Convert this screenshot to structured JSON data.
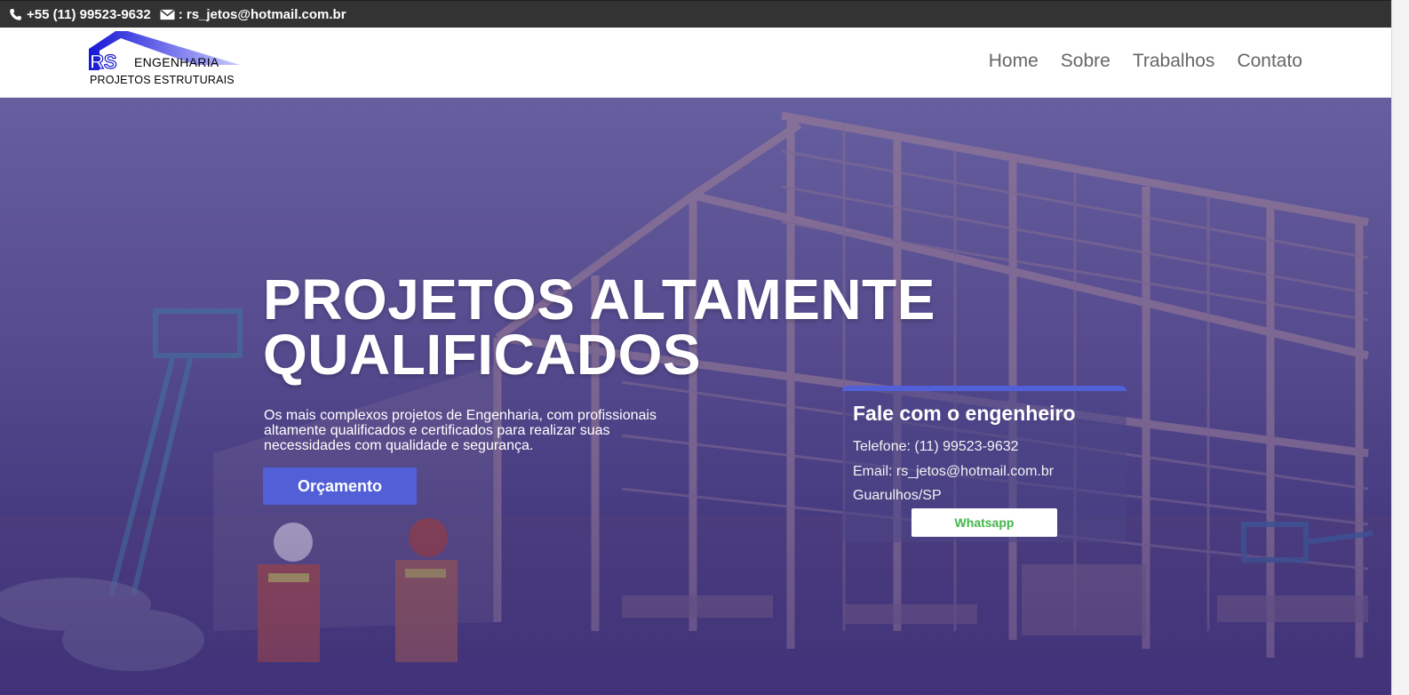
{
  "topbar": {
    "phone": "+55 (11) 99523-9632",
    "email": ": rs_jetos@hotmail.com.br",
    "phone_icon": "phone-icon",
    "email_icon": "envelope-icon"
  },
  "logo": {
    "mark": "RS",
    "line1": "ENGENHARIA",
    "line2": "PROJETOS ESTRUTURAIS"
  },
  "nav": {
    "items": [
      "Home",
      "Sobre",
      "Trabalhos",
      "Contato"
    ]
  },
  "hero": {
    "title_line1": "PROJETOS ALTAMENTE",
    "title_line2": "QUALIFICADOS",
    "subtitle": "Os mais complexos projetos de Engenharia, com profissionais altamente qualificados e certificados para realizar suas necessidades com qualidade e segurança.",
    "cta_label": "Orçamento"
  },
  "contact_card": {
    "title": "Fale com o engenheiro",
    "phone": "Telefone: (11) 99523-9632",
    "email": "Email: rs_jetos@hotmail.com.br",
    "location": "Guarulhos/SP",
    "whatsapp_label": "Whatsapp"
  },
  "colors": {
    "topbar_bg": "#333333",
    "accent": "#5160d6",
    "whatsapp_green": "#43b649",
    "nav_text": "#666666"
  }
}
